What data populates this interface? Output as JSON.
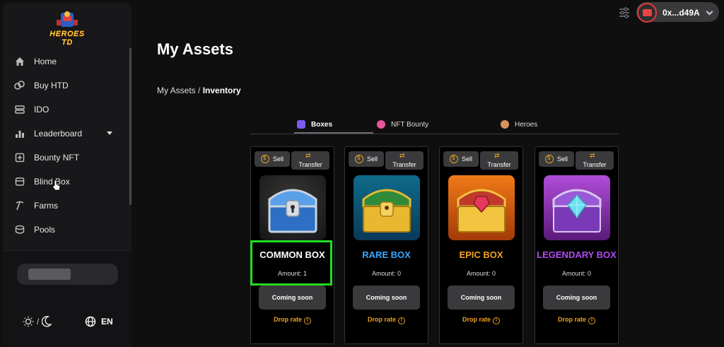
{
  "app": {
    "logo_text": "HEROES TD"
  },
  "sidebar": {
    "items": [
      {
        "label": "Home",
        "icon": "home-icon"
      },
      {
        "label": "Buy HTD",
        "icon": "coins-icon"
      },
      {
        "label": "IDO",
        "icon": "ido-icon"
      },
      {
        "label": "Leaderboard",
        "icon": "leaderboard-icon",
        "has_caret": true
      },
      {
        "label": "Bounty NFT",
        "icon": "bounty-icon"
      },
      {
        "label": "Blind Box",
        "icon": "box-icon"
      },
      {
        "label": "Farms",
        "icon": "pickaxe-icon"
      },
      {
        "label": "Pools",
        "icon": "pools-icon"
      }
    ],
    "theme_separator": "/",
    "language": "EN"
  },
  "header": {
    "wallet_address": "0x...d49A"
  },
  "page": {
    "title": "My Assets",
    "breadcrumb_root": "My Assets /",
    "breadcrumb_current": "Inventory"
  },
  "tabs": [
    {
      "label": "Boxes",
      "active": true,
      "icon": "boxes-icon"
    },
    {
      "label": "NFT Bounty",
      "active": false,
      "icon": "nft-bounty-icon"
    },
    {
      "label": "Heroes",
      "active": false,
      "icon": "heroes-icon"
    }
  ],
  "cards": [
    {
      "name": "COMMON BOX",
      "amount": "Amount: 1",
      "color": "#d8d8d8",
      "theme": "common"
    },
    {
      "name": "RARE BOX",
      "amount": "Amount: 0",
      "color": "#3aa7ff",
      "theme": "rare"
    },
    {
      "name": "EPIC BOX",
      "amount": "Amount: 0",
      "color": "#f3a11f",
      "theme": "epic"
    },
    {
      "name": "LEGENDARY BOX",
      "amount": "Amount: 0",
      "color": "#b04cf0",
      "theme": "legendary"
    }
  ],
  "card_actions": {
    "sell": "Sell",
    "transfer": "Transfer",
    "coming_soon": "Coming soon",
    "drop_rate": "Drop rate",
    "info": "i"
  }
}
